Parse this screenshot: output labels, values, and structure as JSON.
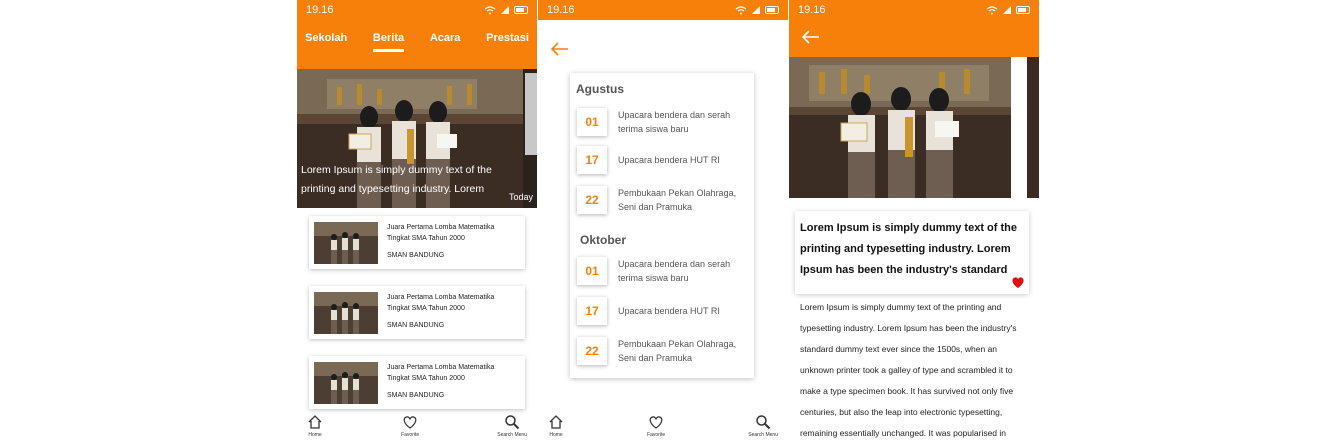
{
  "status": {
    "time": "19.16"
  },
  "screen1": {
    "tabs": [
      "Sekolah",
      "Berita",
      "Acara",
      "Prestasi"
    ],
    "active_tab": "Berita",
    "hero": {
      "caption": "Lorem Ipsum is simply dummy text of the printing and typesetting industry. Lorem",
      "time": "Today"
    },
    "news": [
      {
        "title": "Juara Pertama Lomba Matematika Tingkat SMA Tahun 2000",
        "school": "SMAN  BANDUNG"
      },
      {
        "title": "Juara Pertama Lomba Matematika Tingkat SMA Tahun 2000",
        "school": "SMAN  BANDUNG"
      },
      {
        "title": "Juara Pertama Lomba Matematika Tingkat SMA Tahun 2000",
        "school": "SMAN  BANDUNG"
      }
    ]
  },
  "navbar": {
    "home": "Home",
    "favorite": "Favorite",
    "search": "Search Menu"
  },
  "screen2": {
    "months": [
      {
        "name": "Agustus",
        "events": [
          {
            "date": "01",
            "text": "Upacara bendera dan serah terima siswa baru"
          },
          {
            "date": "17",
            "text": "Upacara bendera HUT RI"
          },
          {
            "date": "22",
            "text": "Pembukaan Pekan Olahraga, Seni dan Pramuka"
          }
        ]
      },
      {
        "name": "Oktober",
        "events": [
          {
            "date": "01",
            "text": "Upacara bendera dan serah terima siswa baru"
          },
          {
            "date": "17",
            "text": "Upacara bendera HUT RI"
          },
          {
            "date": "22",
            "text": "Pembukaan Pekan Olahraga, Seni dan Pramuka"
          }
        ]
      }
    ]
  },
  "screen3": {
    "title": "Lorem Ipsum is simply dummy text of the printing and typesetting industry. Lorem Ipsum has been the industry's standard",
    "body": "Lorem Ipsum is simply dummy text of the printing and typesetting industry. Lorem Ipsum has been the industry's standard dummy text ever since the 1500s, when an unknown printer took a galley of type and scrambled it to make a type specimen book. It has survived not only five centuries, but also the leap into electronic typesetting, remaining essentially unchanged. It was popularised in"
  },
  "colors": {
    "accent": "#f7800a",
    "heart": "#e01010"
  }
}
